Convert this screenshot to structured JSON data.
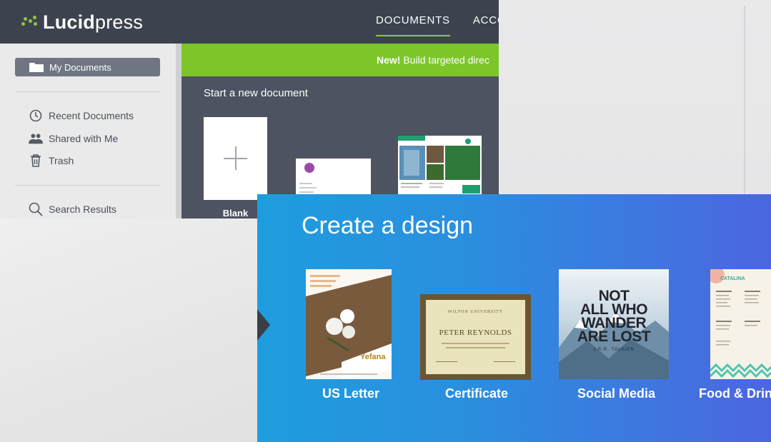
{
  "lucidpress": {
    "logo_bold": "Lucid",
    "logo_light": "press",
    "nav": [
      "DOCUMENTS",
      "ACCOU"
    ],
    "sidebar": {
      "my_documents": "My Documents",
      "items": [
        "Recent Documents",
        "Shared with Me",
        "Trash"
      ],
      "search": "Search Results"
    },
    "banner_bold": "New!",
    "banner_text": " Build targeted direc",
    "start_title": "Start a new document",
    "templates": {
      "blank_label": "Blank"
    },
    "colors": {
      "header": "#3d434e",
      "accent": "#8cc63f",
      "banner": "#7cc62a"
    }
  },
  "canva": {
    "title": "Create a design",
    "designs": [
      "US Letter",
      "Certificate",
      "Social Media",
      "Food & Drin"
    ],
    "letter_brand": "Yefana",
    "certificate_university": "WILTON UNIVERSITY",
    "certificate_name": "PETER REYNOLDS",
    "social_quote": [
      "NOT",
      "ALL WHO",
      "WANDER",
      "ARE LOST"
    ],
    "social_author": "J.R.R. TOLKIEN",
    "menu_brand": "CATALINA",
    "colors": {
      "gradient_start": "#1e9dde",
      "gradient_end": "#4c66df"
    }
  }
}
